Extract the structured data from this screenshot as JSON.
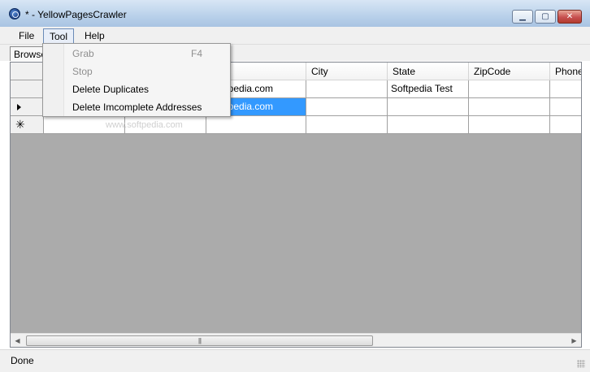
{
  "window": {
    "title": "* - YellowPagesCrawler",
    "minimize_glyph": "▁",
    "maximize_glyph": "▢",
    "close_glyph": "✕"
  },
  "menubar": {
    "items": [
      {
        "label": "File"
      },
      {
        "label": "Tool"
      },
      {
        "label": "Help"
      }
    ]
  },
  "tool_menu": {
    "items": [
      {
        "label": "Grab",
        "shortcut": "F4",
        "enabled": false
      },
      {
        "label": "Stop",
        "shortcut": "",
        "enabled": false
      },
      {
        "label": "Delete Duplicates",
        "shortcut": "",
        "enabled": true
      },
      {
        "label": "Delete Imcomplete Addresses",
        "shortcut": "",
        "enabled": true
      }
    ]
  },
  "toolbar": {
    "browse_label": "Browse"
  },
  "grid": {
    "columns": [
      "",
      "",
      "ress",
      "City",
      "State",
      "ZipCode",
      "Phone"
    ],
    "rows": [
      {
        "cells": [
          "",
          "",
          ".softpedia.com",
          "",
          "Softpedia Test",
          "",
          ""
        ],
        "marker": ""
      },
      {
        "cells": [
          "",
          "",
          ".softpedia.com",
          "",
          "",
          "",
          ""
        ],
        "marker": "current"
      },
      {
        "cells": [
          "",
          "",
          "",
          "",
          "",
          "",
          ""
        ],
        "marker": "new"
      }
    ],
    "new_row_glyph": "✳"
  },
  "hscroll": {
    "left_glyph": "◀",
    "right_glyph": "▶",
    "grip_glyph": "|||"
  },
  "watermark": "www.softpedia.com",
  "status": {
    "text": "Done"
  }
}
